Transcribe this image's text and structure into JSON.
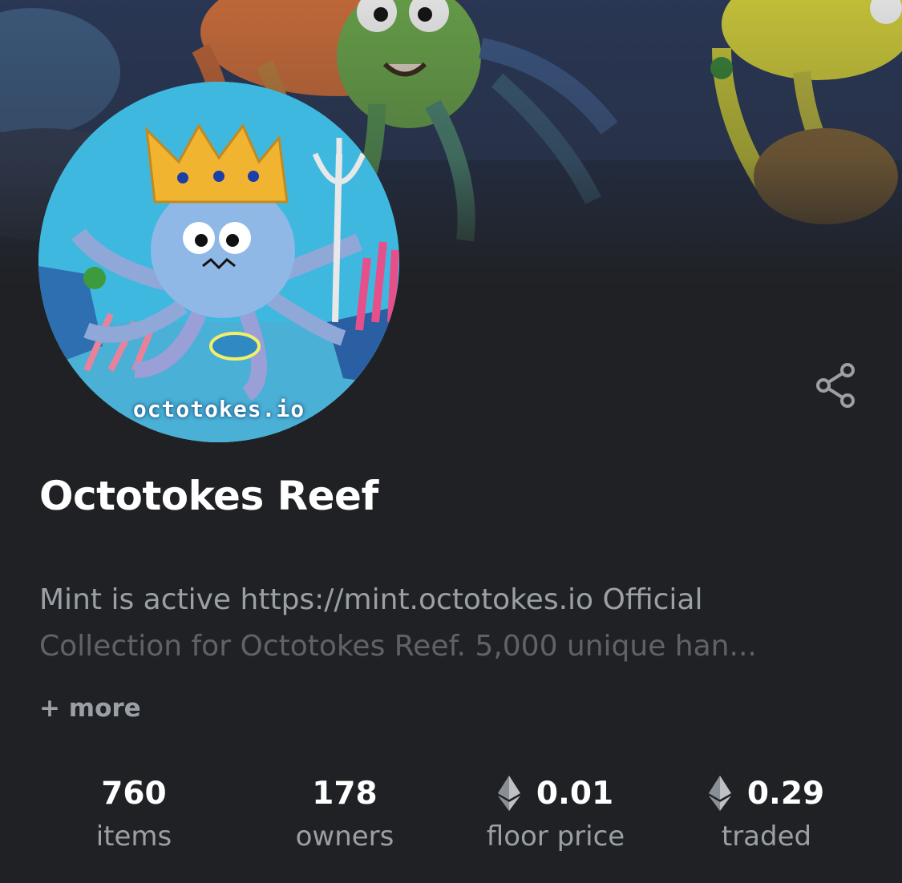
{
  "collection": {
    "title": "Octotokes Reef",
    "avatar_caption": "octotokes.io",
    "description": {
      "prefix": "Mint is active",
      "link": "https://mint.octotokes.io",
      "suffix": "Official",
      "line2": "Collection for Octotokes Reef. 5,000 unique han..."
    },
    "more_label": "+ more"
  },
  "share": {
    "icon": "share-icon"
  },
  "stats": [
    {
      "value": "760",
      "label": "items"
    },
    {
      "value": "178",
      "label": "owners"
    },
    {
      "value": "0.01",
      "label": "floor price",
      "icon": "ethereum-icon"
    },
    {
      "value": "0.29",
      "label": "traded",
      "icon": "ethereum-icon"
    }
  ],
  "colors": {
    "background": "#202124",
    "text_primary": "#ffffff",
    "text_secondary": "#9aa0a6",
    "avatar_sea": "#3fb8e0"
  }
}
